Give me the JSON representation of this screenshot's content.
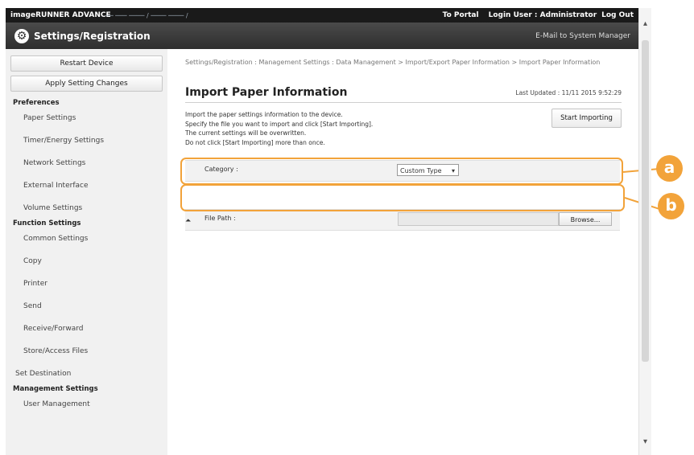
{
  "topbar": {
    "brand": "imageRUNNER ADVANCE",
    "status": "── ─── ──── / ──── ──── /",
    "portal": "To Portal",
    "login": "Login User :  Administrator",
    "logout": "Log Out"
  },
  "titlebar": {
    "title": "Settings/Registration",
    "email": "E-Mail to System Manager"
  },
  "sidebar": {
    "restart": "Restart Device",
    "apply": "Apply Setting Changes",
    "groups": {
      "preferences": "Preferences",
      "function": "Function Settings",
      "management": "Management Settings"
    },
    "preferences_items": [
      "Paper Settings",
      "Timer/Energy Settings",
      "Network Settings",
      "External Interface",
      "Volume Settings"
    ],
    "function_items": [
      "Common Settings",
      "Copy",
      "Printer",
      "Send",
      "Receive/Forward",
      "Store/Access Files"
    ],
    "set_destination": "Set Destination",
    "management_items": [
      "User Management"
    ]
  },
  "main": {
    "breadcrumb": "Settings/Registration : Management Settings : Data Management > Import/Export Paper Information > Import Paper Information",
    "title": "Import Paper Information",
    "last_updated": "Last Updated : 11/11 2015 9:52:29",
    "description": [
      "Import the paper settings information to the device.",
      "Specify the file you want to import and click [Start Importing].",
      "The current settings will be overwritten.",
      "Do not click [Start Importing] more than once."
    ],
    "start_button": "Start Importing",
    "category_label": "Category :",
    "category_value": "Custom Type",
    "file_path_label": "File Path :",
    "browse_button": "Browse...",
    "top_icon": "⏶"
  },
  "callouts": {
    "a": "a",
    "b": "b"
  },
  "colors": {
    "accent": "#f2a33a",
    "topbar": "#1a1a1a",
    "sidebar": "#f1f1f1"
  }
}
